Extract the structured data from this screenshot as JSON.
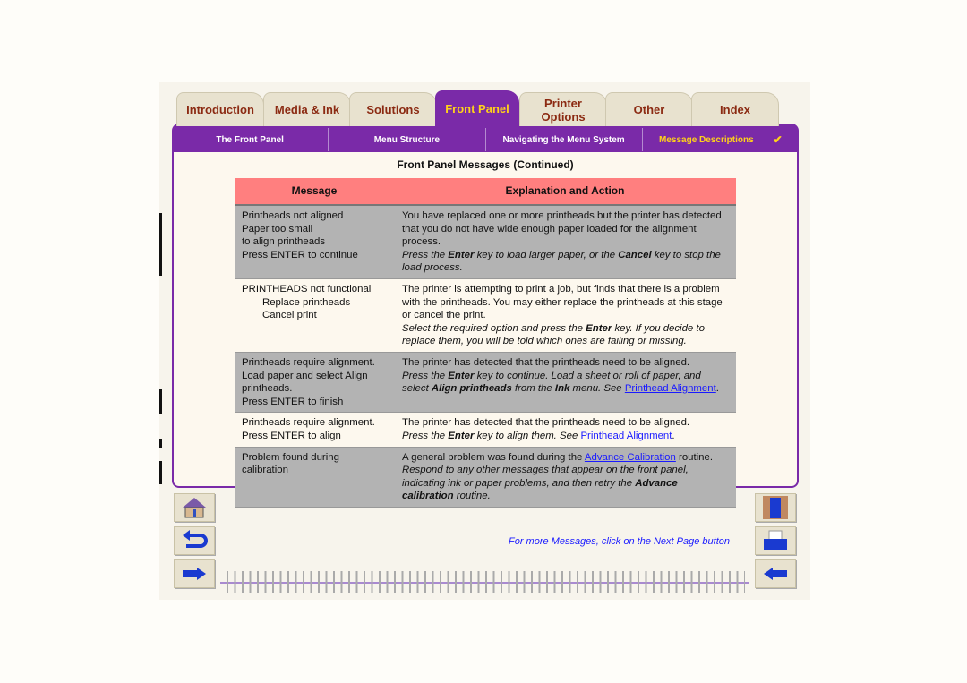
{
  "tabs": [
    {
      "label": "Introduction"
    },
    {
      "label": "Media & Ink"
    },
    {
      "label": "Solutions"
    },
    {
      "label": "Front Panel",
      "active": true
    },
    {
      "label": "Printer Options"
    },
    {
      "label": "Other"
    },
    {
      "label": "Index"
    }
  ],
  "subnav": [
    {
      "label": "The Front Panel"
    },
    {
      "label": "Menu Structure"
    },
    {
      "label": "Navigating the Menu System"
    },
    {
      "label": "Message Descriptions",
      "check": "✔"
    }
  ],
  "page_title": "Front Panel Messages (Continued)",
  "table": {
    "headers": [
      "Message",
      "Explanation and Action"
    ],
    "rows": [
      {
        "msg": [
          "Printheads not aligned",
          "Paper too small",
          "to align printheads",
          "Press ENTER to continue"
        ],
        "exp": [
          [
            {
              "t": "You have replaced one or more printheads but the printer has detected that you do not have wide enough paper loaded for the alignment process."
            }
          ],
          [
            {
              "t": "Press the ",
              "i": 1
            },
            {
              "t": "Enter",
              "i": 1,
              "b": 1
            },
            {
              "t": " key to load larger paper, or the ",
              "i": 1
            },
            {
              "t": "Cancel",
              "i": 1,
              "b": 1
            },
            {
              "t": " key to stop the load process.",
              "i": 1
            }
          ]
        ]
      },
      {
        "msg": [
          "PRINTHEADS not functional",
          "Replace printheads",
          "Cancel print"
        ],
        "exp": [
          [
            {
              "t": "The printer is attempting to print a job, but finds that there is a problem with the printheads. You may either replace the printheads at this stage or cancel the print."
            }
          ],
          [
            {
              "t": "Select the required option and press the ",
              "i": 1
            },
            {
              "t": "Enter",
              "i": 1,
              "b": 1
            },
            {
              "t": " key. If you decide to replace them, you will be told which ones are failing or missing.",
              "i": 1
            }
          ]
        ]
      },
      {
        "msg": [
          "Printheads require alignment.",
          "Load paper and select Align printheads.",
          "Press ENTER to finish"
        ],
        "exp": [
          [
            {
              "t": "The printer has detected that the printheads need to be aligned."
            }
          ],
          [
            {
              "t": "Press the ",
              "i": 1
            },
            {
              "t": "Enter",
              "i": 1,
              "b": 1
            },
            {
              "t": " key to continue. Load a sheet or roll of paper, and select ",
              "i": 1
            },
            {
              "t": "Align printheads",
              "i": 1,
              "b": 1
            },
            {
              "t": " from the ",
              "i": 1
            },
            {
              "t": "Ink",
              "i": 1,
              "b": 1
            },
            {
              "t": " menu. See ",
              "i": 1
            },
            {
              "t": "Printhead Alignment",
              "link": 1
            },
            {
              "t": "."
            }
          ]
        ]
      },
      {
        "msg": [
          "Printheads require alignment.",
          "Press ENTER to align"
        ],
        "exp": [
          [
            {
              "t": "The printer has detected that the printheads need to be aligned."
            }
          ],
          [
            {
              "t": "Press the ",
              "i": 1
            },
            {
              "t": "Enter",
              "i": 1,
              "b": 1
            },
            {
              "t": " key to align them. See ",
              "i": 1
            },
            {
              "t": "Printhead Alignment",
              "link": 1
            },
            {
              "t": "."
            }
          ]
        ]
      },
      {
        "msg": [
          "Problem found during",
          "calibration"
        ],
        "exp": [
          [
            {
              "t": "A general problem was found during the "
            },
            {
              "t": "Advance Calibration",
              "link": 1
            },
            {
              "t": " routine."
            }
          ],
          [
            {
              "t": "Respond to any other messages that appear on the front panel, indicating ink or paper problems, and then retry the ",
              "i": 1
            },
            {
              "t": "Advance calibration",
              "i": 1,
              "b": 1
            },
            {
              "t": " routine.",
              "i": 1
            }
          ]
        ]
      }
    ]
  },
  "footer_note": "For more Messages, click on the Next Page button",
  "nav": {
    "left": [
      "home-icon",
      "back-icon",
      "previous-page-icon"
    ],
    "right": [
      "contents-icon",
      "print-icon",
      "next-page-icon"
    ]
  },
  "colors": {
    "accent": "#7a2aa8",
    "active_tab_text": "#ffd21a",
    "header": "#ff7f7f",
    "link": "#1a1aff"
  }
}
